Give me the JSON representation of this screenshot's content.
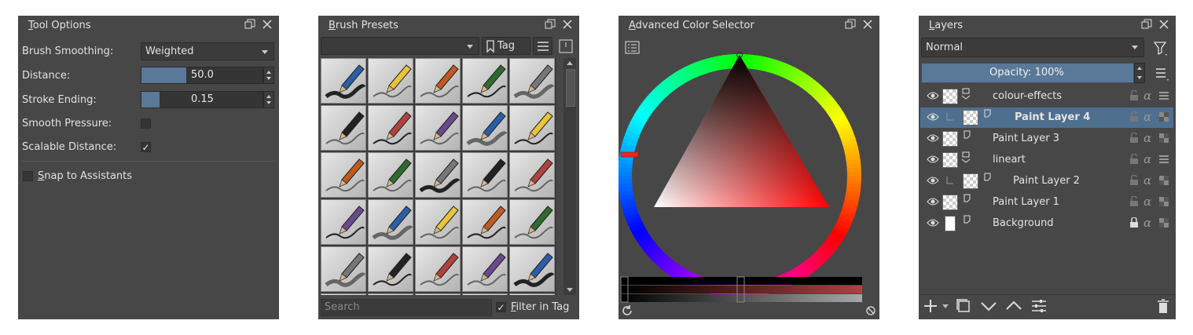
{
  "tool_options": {
    "title_prefix": "T",
    "title_rest": "ool Options",
    "brush_smoothing_label": "Brush Smoothing:",
    "brush_smoothing_value": "Weighted",
    "distance_label": "Distance:",
    "distance_value": "50.0",
    "distance_fraction": 0.37,
    "stroke_ending_label": "Stroke Ending:",
    "stroke_ending_value": "0.15",
    "stroke_ending_fraction": 0.15,
    "smooth_pressure_label": "Smooth Pressure:",
    "smooth_pressure_checked": "",
    "scalable_distance_label": "Scalable Distance:",
    "scalable_distance_checked": "✓",
    "snap_prefix": "S",
    "snap_rest": "nap to Assistants"
  },
  "brush_presets": {
    "title_prefix": "B",
    "title_rest": "rush Presets",
    "tag_label": "Tag",
    "search_placeholder": "Search",
    "filter_check": "✓",
    "filter_prefix": "F",
    "filter_rest": "ilter in Tag"
  },
  "color_selector": {
    "title_prefix": "A",
    "title_rest": "dvanced Color Selector"
  },
  "layers": {
    "title_prefix": "L",
    "title_rest": "ayers",
    "blend_mode": "Normal",
    "opacity_label": "Opacity:  100%",
    "rows": [
      {
        "name": "colour-effects",
        "type": "group"
      },
      {
        "name": "Paint Layer 4",
        "type": "paint",
        "selected": true
      },
      {
        "name": "Paint Layer 3",
        "type": "paint"
      },
      {
        "name": "lineart",
        "type": "group"
      },
      {
        "name": "Paint Layer 2",
        "type": "paint"
      },
      {
        "name": "Paint Layer 1",
        "type": "paint"
      },
      {
        "name": "Background",
        "type": "paint",
        "locked": true
      }
    ]
  },
  "colors": {
    "panel_bg": "#474747",
    "accent": "#5a7999",
    "selected_row": "#4f6f8f"
  }
}
